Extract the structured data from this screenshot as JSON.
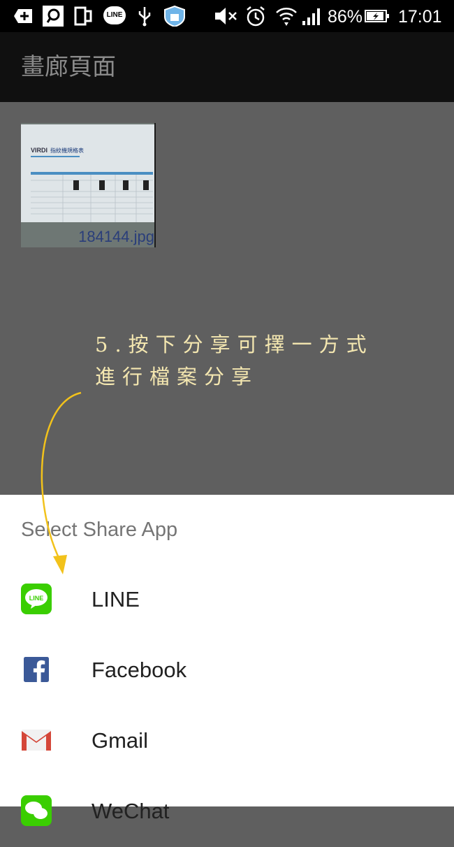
{
  "status_bar": {
    "line_badge": "LINE",
    "battery": "86%",
    "time": "17:01"
  },
  "header": {
    "title": "畫廊頁面"
  },
  "gallery": {
    "items": [
      {
        "file_name": "184144.jpg",
        "doc_brand": "VIRDI",
        "doc_title": "指紋機規格表"
      }
    ]
  },
  "annotation": {
    "line1": "5.按下分享可擇一方式",
    "line2": "進行檔案分享",
    "color": "#f4e7b0"
  },
  "share_sheet": {
    "title": "Select Share App",
    "apps": [
      {
        "label": "LINE",
        "icon": "line-icon"
      },
      {
        "label": "Facebook",
        "icon": "facebook-icon"
      },
      {
        "label": "Gmail",
        "icon": "gmail-icon"
      },
      {
        "label": "WeChat",
        "icon": "wechat-icon"
      }
    ]
  },
  "colors": {
    "line_green": "#3ACE01",
    "facebook_blue": "#3B5998",
    "gmail_red": "#D44638",
    "arrow_yellow": "#f2c21b"
  }
}
